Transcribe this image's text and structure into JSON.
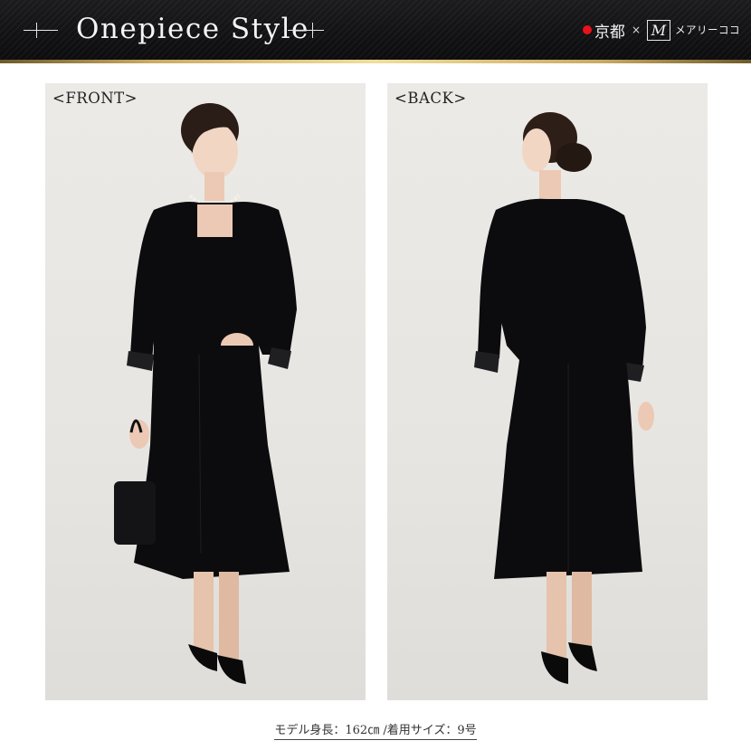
{
  "header": {
    "title": "Onepiece Style",
    "brand": {
      "kyoto": "京都",
      "times": "×",
      "m_logo": "M",
      "name": "メアリーココ"
    }
  },
  "photos": {
    "front": {
      "label": "<FRONT>",
      "content": "model-front-view"
    },
    "back": {
      "label": "<BACK>",
      "content": "model-back-view"
    }
  },
  "caption": "モデル身長：162㎝ /着用サイズ：9号",
  "colors": {
    "header_bg": "#141416",
    "gold": "#c9aa62",
    "brand_dot": "#e8121b",
    "photo_bg": "#e9e7e3",
    "garment": "#0c0c0e"
  }
}
